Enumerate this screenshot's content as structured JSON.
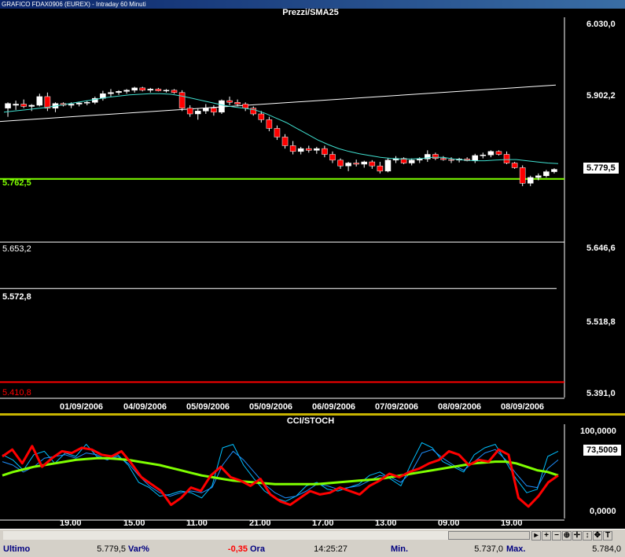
{
  "window_title": "GRAFICO FDAX0906 (EUREX) - Intraday 60 Minuti",
  "price_panel": {
    "title": "Prezzi/SMA25",
    "y_axis_ticks": [
      "6.030,0",
      "5.902,2",
      "5.646,6",
      "5.518,8",
      "5.391,0"
    ],
    "current_price_box": "5.779,5",
    "levels": [
      {
        "label": "5.762,5",
        "value": 5762.5,
        "color": "#7fff00"
      },
      {
        "label": "5.653,2",
        "value": 5653.2,
        "color": "#ffffff"
      },
      {
        "label": "5.572,8",
        "value": 5572.8,
        "color": "#ffffff"
      },
      {
        "label": "5.410,8",
        "value": 5410.8,
        "color": "#ff0000"
      }
    ],
    "date_labels": [
      "01/09/2006",
      "04/09/2006",
      "05/09/2006",
      "05/09/2006",
      "06/09/2006",
      "07/09/2006",
      "08/09/2006",
      "08/09/2006"
    ]
  },
  "osc_panel": {
    "title": "CCI/STOCH",
    "y_axis_ticks": [
      "100,0000",
      "0,0000"
    ],
    "current_value_box": "73,5009",
    "time_labels": [
      "19.00",
      "15.00",
      "11.00",
      "21.00",
      "17.00",
      "13.00",
      "09.00",
      "19.00"
    ]
  },
  "chart_data": [
    {
      "type": "candlestick",
      "title": "Prezzi/SMA25",
      "ylim": [
        5391.0,
        6030.0
      ],
      "candles": [
        {
          "o": 5885,
          "h": 5895,
          "l": 5870,
          "c": 5893
        },
        {
          "o": 5890,
          "h": 5898,
          "l": 5882,
          "c": 5892
        },
        {
          "o": 5892,
          "h": 5900,
          "l": 5885,
          "c": 5888
        },
        {
          "o": 5888,
          "h": 5892,
          "l": 5880,
          "c": 5890
        },
        {
          "o": 5890,
          "h": 5910,
          "l": 5888,
          "c": 5905
        },
        {
          "o": 5905,
          "h": 5912,
          "l": 5880,
          "c": 5885
        },
        {
          "o": 5885,
          "h": 5895,
          "l": 5878,
          "c": 5893
        },
        {
          "o": 5893,
          "h": 5895,
          "l": 5888,
          "c": 5890
        },
        {
          "o": 5890,
          "h": 5895,
          "l": 5885,
          "c": 5892
        },
        {
          "o": 5892,
          "h": 5896,
          "l": 5888,
          "c": 5894
        },
        {
          "o": 5894,
          "h": 5898,
          "l": 5890,
          "c": 5895
        },
        {
          "o": 5895,
          "h": 5905,
          "l": 5892,
          "c": 5902
        },
        {
          "o": 5902,
          "h": 5915,
          "l": 5898,
          "c": 5910
        },
        {
          "o": 5910,
          "h": 5918,
          "l": 5905,
          "c": 5912
        },
        {
          "o": 5912,
          "h": 5916,
          "l": 5908,
          "c": 5914
        },
        {
          "o": 5914,
          "h": 5918,
          "l": 5910,
          "c": 5916
        },
        {
          "o": 5916,
          "h": 5922,
          "l": 5912,
          "c": 5920
        },
        {
          "o": 5920,
          "h": 5922,
          "l": 5914,
          "c": 5916
        },
        {
          "o": 5916,
          "h": 5920,
          "l": 5912,
          "c": 5918
        },
        {
          "o": 5918,
          "h": 5920,
          "l": 5914,
          "c": 5915
        },
        {
          "o": 5915,
          "h": 5918,
          "l": 5912,
          "c": 5916
        },
        {
          "o": 5916,
          "h": 5918,
          "l": 5910,
          "c": 5912
        },
        {
          "o": 5912,
          "h": 5916,
          "l": 5880,
          "c": 5885
        },
        {
          "o": 5885,
          "h": 5890,
          "l": 5870,
          "c": 5875
        },
        {
          "o": 5875,
          "h": 5885,
          "l": 5865,
          "c": 5880
        },
        {
          "o": 5880,
          "h": 5892,
          "l": 5875,
          "c": 5885
        },
        {
          "o": 5885,
          "h": 5890,
          "l": 5872,
          "c": 5878
        },
        {
          "o": 5878,
          "h": 5900,
          "l": 5875,
          "c": 5898
        },
        {
          "o": 5898,
          "h": 5905,
          "l": 5890,
          "c": 5895
        },
        {
          "o": 5895,
          "h": 5900,
          "l": 5888,
          "c": 5892
        },
        {
          "o": 5892,
          "h": 5895,
          "l": 5880,
          "c": 5885
        },
        {
          "o": 5885,
          "h": 5888,
          "l": 5872,
          "c": 5875
        },
        {
          "o": 5875,
          "h": 5880,
          "l": 5860,
          "c": 5865
        },
        {
          "o": 5865,
          "h": 5870,
          "l": 5845,
          "c": 5850
        },
        {
          "o": 5850,
          "h": 5855,
          "l": 5830,
          "c": 5835
        },
        {
          "o": 5835,
          "h": 5840,
          "l": 5815,
          "c": 5820
        },
        {
          "o": 5820,
          "h": 5828,
          "l": 5805,
          "c": 5810
        },
        {
          "o": 5810,
          "h": 5818,
          "l": 5805,
          "c": 5815
        },
        {
          "o": 5815,
          "h": 5820,
          "l": 5808,
          "c": 5812
        },
        {
          "o": 5812,
          "h": 5818,
          "l": 5806,
          "c": 5815
        },
        {
          "o": 5815,
          "h": 5820,
          "l": 5800,
          "c": 5805
        },
        {
          "o": 5805,
          "h": 5810,
          "l": 5790,
          "c": 5795
        },
        {
          "o": 5795,
          "h": 5798,
          "l": 5780,
          "c": 5785
        },
        {
          "o": 5785,
          "h": 5792,
          "l": 5776,
          "c": 5790
        },
        {
          "o": 5790,
          "h": 5796,
          "l": 5784,
          "c": 5788
        },
        {
          "o": 5788,
          "h": 5794,
          "l": 5782,
          "c": 5792
        },
        {
          "o": 5792,
          "h": 5795,
          "l": 5780,
          "c": 5785
        },
        {
          "o": 5785,
          "h": 5792,
          "l": 5772,
          "c": 5776
        },
        {
          "o": 5776,
          "h": 5798,
          "l": 5774,
          "c": 5795
        },
        {
          "o": 5795,
          "h": 5802,
          "l": 5790,
          "c": 5798
        },
        {
          "o": 5798,
          "h": 5800,
          "l": 5788,
          "c": 5790
        },
        {
          "o": 5790,
          "h": 5798,
          "l": 5786,
          "c": 5795
        },
        {
          "o": 5795,
          "h": 5800,
          "l": 5790,
          "c": 5797
        },
        {
          "o": 5797,
          "h": 5812,
          "l": 5792,
          "c": 5805
        },
        {
          "o": 5805,
          "h": 5808,
          "l": 5795,
          "c": 5798
        },
        {
          "o": 5798,
          "h": 5802,
          "l": 5794,
          "c": 5796
        },
        {
          "o": 5796,
          "h": 5800,
          "l": 5790,
          "c": 5795
        },
        {
          "o": 5795,
          "h": 5799,
          "l": 5791,
          "c": 5797
        },
        {
          "o": 5797,
          "h": 5800,
          "l": 5793,
          "c": 5794
        },
        {
          "o": 5794,
          "h": 5806,
          "l": 5790,
          "c": 5803
        },
        {
          "o": 5803,
          "h": 5808,
          "l": 5798,
          "c": 5804
        },
        {
          "o": 5804,
          "h": 5812,
          "l": 5800,
          "c": 5810
        },
        {
          "o": 5810,
          "h": 5812,
          "l": 5803,
          "c": 5805
        },
        {
          "o": 5805,
          "h": 5810,
          "l": 5788,
          "c": 5790
        },
        {
          "o": 5790,
          "h": 5792,
          "l": 5780,
          "c": 5782
        },
        {
          "o": 5782,
          "h": 5786,
          "l": 5750,
          "c": 5755
        },
        {
          "o": 5755,
          "h": 5768,
          "l": 5750,
          "c": 5765
        },
        {
          "o": 5765,
          "h": 5772,
          "l": 5760,
          "c": 5768
        },
        {
          "o": 5768,
          "h": 5778,
          "l": 5765,
          "c": 5775
        },
        {
          "o": 5775,
          "h": 5781,
          "l": 5772,
          "c": 5779
        }
      ],
      "sma25": [
        5878,
        5880,
        5882,
        5884,
        5886,
        5889,
        5892,
        5895,
        5898,
        5901,
        5904,
        5906,
        5908,
        5909,
        5910,
        5910,
        5909,
        5906,
        5902,
        5898,
        5894,
        5890,
        5887,
        5885,
        5882,
        5876,
        5868,
        5860,
        5850,
        5840,
        5830,
        5822,
        5815,
        5810,
        5806,
        5803,
        5800,
        5798,
        5797,
        5797,
        5798,
        5800,
        5800,
        5797,
        5795,
        5794,
        5794,
        5795,
        5796,
        5796,
        5794,
        5792,
        5790,
        5789
      ],
      "trendline": {
        "start": 5862,
        "end": 5925
      }
    },
    {
      "type": "line",
      "title": "CCI/STOCH",
      "ylim": [
        0,
        100
      ],
      "series": [
        {
          "color": "#ff0000",
          "values": [
            70,
            78,
            62,
            82,
            58,
            68,
            76,
            74,
            80,
            78,
            72,
            70,
            76,
            62,
            46,
            38,
            30,
            14,
            22,
            34,
            30,
            48,
            58,
            46,
            42,
            36,
            44,
            26,
            18,
            14,
            22,
            30,
            26,
            28,
            34,
            30,
            26,
            36,
            42,
            50,
            46,
            52,
            56,
            62,
            66,
            76,
            72,
            60,
            66,
            64,
            78,
            72,
            22,
            12,
            24,
            40,
            48
          ]
        },
        {
          "color": "#00bfff",
          "values": [
            72,
            66,
            54,
            72,
            76,
            62,
            74,
            70,
            84,
            70,
            66,
            72,
            60,
            40,
            34,
            24,
            26,
            30,
            28,
            22,
            36,
            80,
            84,
            60,
            44,
            30,
            22,
            18,
            24,
            36,
            40,
            32,
            30,
            34,
            38,
            48,
            52,
            44,
            36,
            62,
            86,
            80,
            64,
            58,
            52,
            72,
            80,
            84,
            64,
            44,
            28,
            32,
            70,
            76
          ]
        },
        {
          "color": "#1e90ff",
          "values": [
            64,
            60,
            52,
            58,
            68,
            70,
            72,
            68,
            74,
            72,
            66,
            70,
            62,
            48,
            36,
            28,
            24,
            28,
            30,
            28,
            34,
            60,
            76,
            66,
            52,
            38,
            28,
            22,
            24,
            30,
            38,
            36,
            32,
            34,
            36,
            42,
            48,
            46,
            40,
            52,
            74,
            78,
            68,
            60,
            54,
            64,
            74,
            78,
            66,
            50,
            36,
            34,
            56,
            66
          ]
        },
        {
          "color": "#7fff00",
          "values": [
            48,
            52,
            55,
            58,
            60,
            62,
            64,
            66,
            67,
            68,
            68,
            67,
            66,
            64,
            62,
            60,
            57,
            54,
            51,
            48,
            46,
            44,
            42,
            41,
            40,
            39,
            38,
            38,
            38,
            38,
            38,
            39,
            40,
            41,
            42,
            43,
            44,
            46,
            48,
            50,
            52,
            54,
            56,
            58,
            60,
            62,
            63,
            64,
            64,
            62,
            58,
            54,
            52,
            48
          ]
        }
      ]
    }
  ],
  "status_bar": {
    "ultimo_label": "Ultimo",
    "ultimo_value": "5.779,5",
    "var_label": "Var%",
    "var_value": "-0,35",
    "ora_label": "Ora",
    "ora_value": "14:25:27",
    "min_label": "Min.",
    "min_value": "5.737,0",
    "max_label": "Max.",
    "max_value": "5.784,0"
  },
  "toolbar_icons": [
    "scroll-left-icon",
    "scroll-right-icon",
    "zoom-in-icon",
    "zoom-out-icon",
    "crosshair-icon",
    "cursor-icon",
    "move-icon",
    "text-icon"
  ],
  "colors": {
    "up_candle": "#ffffff",
    "down_candle": "#ff0000",
    "sma": "#40e0d0",
    "trendline": "#ffffff",
    "support": "#7fff00",
    "separator": "#c8b400"
  }
}
